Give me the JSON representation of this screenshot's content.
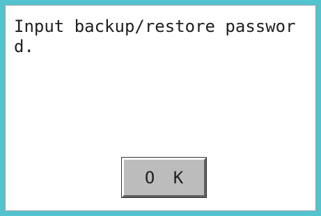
{
  "dialog": {
    "message_line1": "Input backup/restore passwor",
    "message_line2": "d.",
    "ok_label": "O K"
  },
  "colors": {
    "frame": "#52c3cf",
    "panel": "#ffffff",
    "button_face": "#bcbcbc",
    "text": "#202020"
  }
}
